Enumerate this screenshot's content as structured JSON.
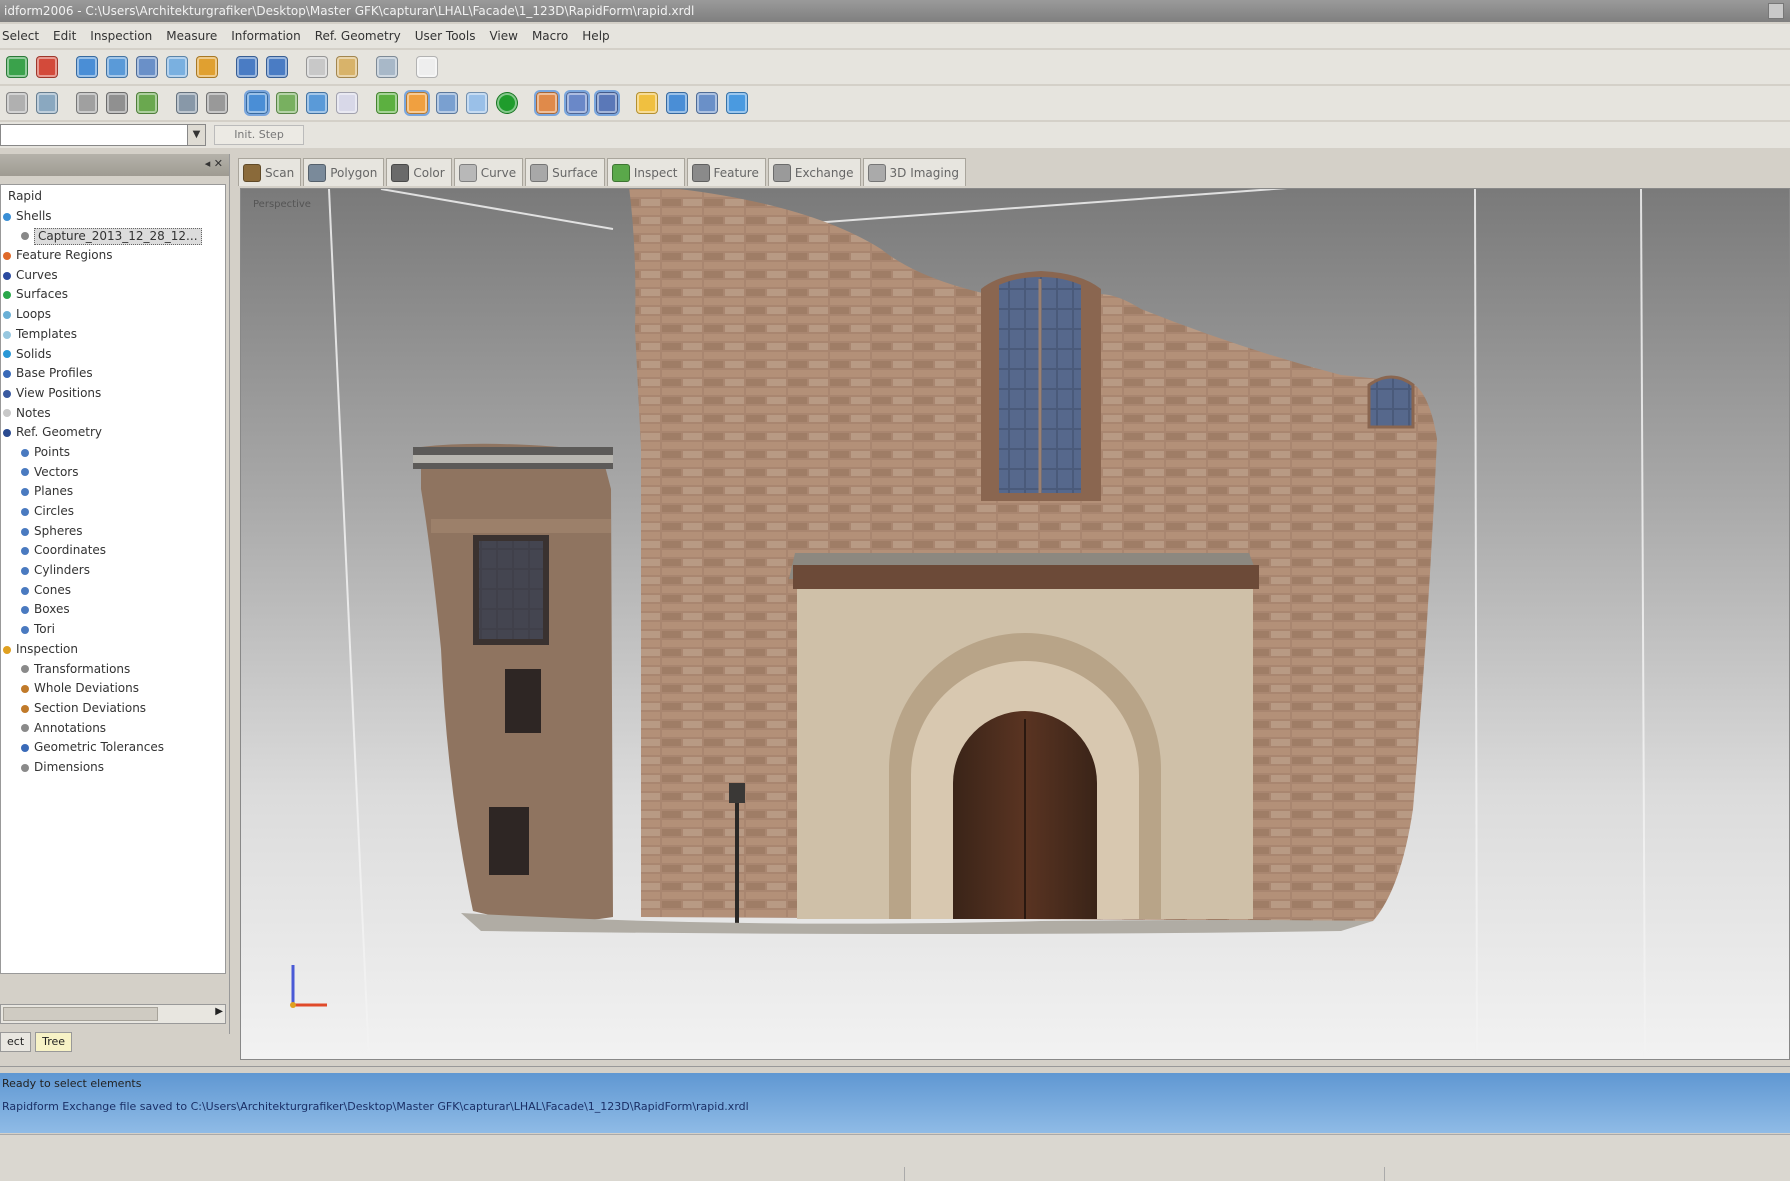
{
  "window": {
    "title": "idform2006 - C:\\Users\\Architekturgrafiker\\Desktop\\Master GFK\\capturar\\LHAL\\Facade\\1_123D\\RapidForm\\rapid.xrdl"
  },
  "menu": [
    "Select",
    "Edit",
    "Inspection",
    "Measure",
    "Information",
    "Ref. Geometry",
    "User Tools",
    "View",
    "Macro",
    "Help"
  ],
  "toolbar_row1": [
    {
      "icon": "globe-green-icon",
      "color": "#3aa24b"
    },
    {
      "icon": "stop-red-icon",
      "color": "#d34a3a"
    },
    {
      "icon": "import-icon",
      "color": "#4a8ed6"
    },
    {
      "icon": "export-icon",
      "color": "#5a9ad8"
    },
    {
      "icon": "save-icon",
      "color": "#6a90c8"
    },
    {
      "icon": "cloud-icon",
      "color": "#7ab0e0"
    },
    {
      "icon": "palette-icon",
      "color": "#e0a030"
    },
    {
      "icon": "undo-icon",
      "color": "#4a7cc4"
    },
    {
      "icon": "redo-icon",
      "color": "#4a7cc4"
    },
    {
      "icon": "copy-icon",
      "color": "#c8c8c8"
    },
    {
      "icon": "paste-icon",
      "color": "#d8b36a"
    },
    {
      "icon": "select-window-icon",
      "color": "#a8b8c8"
    },
    {
      "icon": "pointer-icon",
      "color": "#eeeeee"
    }
  ],
  "toolbar_row2": [
    {
      "icon": "zoom-icon",
      "color": "#b0b0b0"
    },
    {
      "icon": "fit-icon",
      "color": "#8aa8c0"
    },
    {
      "icon": "mesh-icon",
      "color": "#a0a0a0"
    },
    {
      "icon": "points-icon",
      "color": "#909090"
    },
    {
      "icon": "layers-icon",
      "color": "#6aa84f"
    },
    {
      "icon": "cube-icon",
      "color": "#8898a8"
    },
    {
      "icon": "sphere-icon",
      "color": "#999999"
    },
    {
      "icon": "view-iso-icon",
      "color": "#4a8ed6",
      "active": true
    },
    {
      "icon": "grid-snap-icon",
      "color": "#78b060"
    },
    {
      "icon": "rotate-icon",
      "color": "#5a9ad8"
    },
    {
      "icon": "window-icon",
      "color": "#d8d8e8"
    },
    {
      "icon": "check-green-icon",
      "color": "#5cb040"
    },
    {
      "icon": "shape-orange-icon",
      "color": "#f0a040",
      "active": true
    },
    {
      "icon": "link-icon",
      "color": "#7aa0d0"
    },
    {
      "icon": "cloud2-icon",
      "color": "#9ac0e8"
    },
    {
      "icon": "record-green-icon",
      "color": "#1f9c2c",
      "round": true
    },
    {
      "icon": "render-icon",
      "color": "#e08a4a",
      "active": true
    },
    {
      "icon": "edge-icon",
      "color": "#6a88c8",
      "active": true
    },
    {
      "icon": "face-icon",
      "color": "#5a78b8",
      "active": true
    },
    {
      "icon": "light-icon",
      "color": "#f0c040"
    },
    {
      "icon": "camera-icon",
      "color": "#4a8ed6"
    },
    {
      "icon": "section-icon",
      "color": "#6a90c8"
    },
    {
      "icon": "bottle-icon",
      "color": "#4a9ae0"
    }
  ],
  "combo": {
    "value": ""
  },
  "small_button": "Init. Step",
  "tree": {
    "nodes": [
      {
        "label": "Rapid",
        "color": "",
        "indent": 0
      },
      {
        "label": "Shells",
        "color": "#3a8fd6",
        "indent": 0
      },
      {
        "label": "Capture_2013_12_28_12...",
        "color": "#888888",
        "indent": 1,
        "selected": true
      },
      {
        "label": "Feature Regions",
        "color": "#e06a2a",
        "indent": 0
      },
      {
        "label": "Curves",
        "color": "#2a4aa0",
        "indent": 0
      },
      {
        "label": "Surfaces",
        "color": "#2aa84a",
        "indent": 0
      },
      {
        "label": "Loops",
        "color": "#6ab0d6",
        "indent": 0
      },
      {
        "label": "Templates",
        "color": "#98c8e0",
        "indent": 0
      },
      {
        "label": "Solids",
        "color": "#2a98d6",
        "indent": 0
      },
      {
        "label": "Base Profiles",
        "color": "#3a6ab8",
        "indent": 0
      },
      {
        "label": "View Positions",
        "color": "#3a5aa0",
        "indent": 0
      },
      {
        "label": "Notes",
        "color": "#c8c8c8",
        "indent": 0
      },
      {
        "label": "Ref. Geometry",
        "color": "#2a4a90",
        "indent": 0
      },
      {
        "label": "Points",
        "color": "#4a7ac0",
        "indent": 1
      },
      {
        "label": "Vectors",
        "color": "#4a7ac0",
        "indent": 1
      },
      {
        "label": "Planes",
        "color": "#4a7ac0",
        "indent": 1
      },
      {
        "label": "Circles",
        "color": "#4a7ac0",
        "indent": 1
      },
      {
        "label": "Spheres",
        "color": "#4a7ac0",
        "indent": 1
      },
      {
        "label": "Coordinates",
        "color": "#4a7ac0",
        "indent": 1
      },
      {
        "label": "Cylinders",
        "color": "#4a7ac0",
        "indent": 1
      },
      {
        "label": "Cones",
        "color": "#4a7ac0",
        "indent": 1
      },
      {
        "label": "Boxes",
        "color": "#4a7ac0",
        "indent": 1
      },
      {
        "label": "Tori",
        "color": "#4a7ac0",
        "indent": 1
      },
      {
        "label": "Inspection",
        "color": "#e0a020",
        "indent": 0
      },
      {
        "label": "Transformations",
        "color": "#8a8a8a",
        "indent": 1
      },
      {
        "label": "Whole Deviations",
        "color": "#c07a2a",
        "indent": 1
      },
      {
        "label": "Section Deviations",
        "color": "#c07a2a",
        "indent": 1
      },
      {
        "label": "Annotations",
        "color": "#8a8a8a",
        "indent": 1
      },
      {
        "label": "Geometric Tolerances",
        "color": "#3a6ab8",
        "indent": 1
      },
      {
        "label": "Dimensions",
        "color": "#8a8a8a",
        "indent": 1
      }
    ],
    "tabs": [
      "ect",
      "Tree"
    ]
  },
  "tabs": [
    {
      "label": "Scan",
      "color": "#8a6a3a"
    },
    {
      "label": "Polygon",
      "color": "#7a8a9a"
    },
    {
      "label": "Color",
      "color": "#6a6a6a"
    },
    {
      "label": "Curve",
      "color": "#b8b8b8"
    },
    {
      "label": "Surface",
      "color": "#a8a8a8"
    },
    {
      "label": "Inspect",
      "color": "#5aa84a"
    },
    {
      "label": "Feature",
      "color": "#8a8a8a"
    },
    {
      "label": "Exchange",
      "color": "#9a9a9a"
    },
    {
      "label": "3D Imaging",
      "color": "#aaaaaa"
    }
  ],
  "viewport": {
    "label": "Perspective"
  },
  "status": {
    "line1": "Ready to select elements",
    "line2": "Rapidform Exchange file saved to C:\\Users\\Architekturgrafiker\\Desktop\\Master GFK\\capturar\\LHAL\\Facade\\1_123D\\RapidForm\\rapid.xrdl"
  }
}
